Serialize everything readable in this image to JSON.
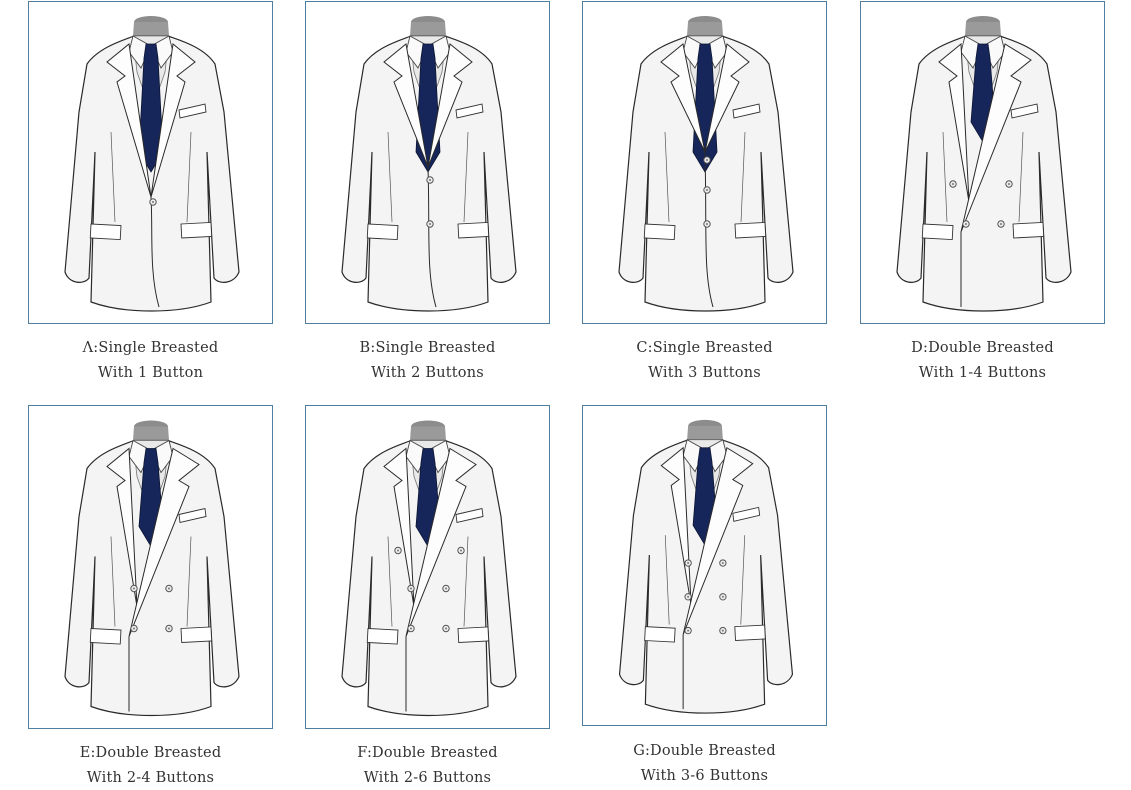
{
  "options": [
    {
      "line1": "Λ:Single Breasted",
      "line2": "With 1 Button",
      "style": "sb1"
    },
    {
      "line1": "B:Single Breasted",
      "line2": "With 2 Buttons",
      "style": "sb2"
    },
    {
      "line1": "C:Single Breasted",
      "line2": "With 3 Buttons",
      "style": "sb3"
    },
    {
      "line1": "D:Double Breasted",
      "line2": "With 1-4 Buttons",
      "style": "db14"
    },
    {
      "line1": "E:Double Breasted",
      "line2": "With 2-4 Buttons",
      "style": "db24"
    },
    {
      "line1": "F:Double Breasted",
      "line2": "With 2-6 Buttons",
      "style": "db26"
    },
    {
      "line1": "G:Double Breasted",
      "line2": "With 3-6 Buttons",
      "style": "db36"
    }
  ],
  "colors": {
    "frame": "#4f7ea0",
    "tie": "#16255a",
    "jacket": "#f4f4f4",
    "shirt": "#e9e9e9"
  }
}
